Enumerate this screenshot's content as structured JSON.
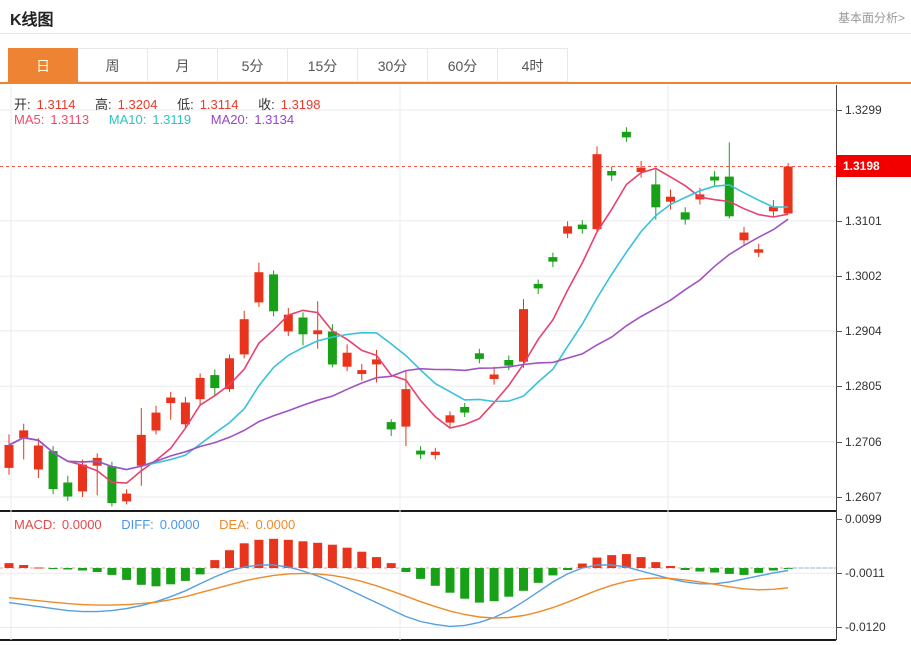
{
  "header": {
    "title": "K线图",
    "fundamental_link": "基本面分析>"
  },
  "tabs": {
    "items": [
      "日",
      "周",
      "月",
      "5分",
      "15分",
      "30分",
      "60分",
      "4时"
    ],
    "active_index": 0
  },
  "ohlc_legend": {
    "open_label": "开:",
    "open": "1.3114",
    "high_label": "高:",
    "high": "1.3204",
    "low_label": "低:",
    "low": "1.3114",
    "close_label": "收:",
    "close": "1.3198"
  },
  "ma_legend": {
    "ma5_label": "MA5:",
    "ma5": "1.3113",
    "ma10_label": "MA10:",
    "ma10": "1.3119",
    "ma20_label": "MA20:",
    "ma20": "1.3134"
  },
  "macd_legend": {
    "macd_label": "MACD:",
    "macd": "0.0000",
    "diff_label": "DIFF:",
    "diff": "0.0000",
    "dea_label": "DEA:",
    "dea": "0.0000"
  },
  "colors": {
    "up": "#e8341c",
    "down": "#18a018",
    "ma5": "#e8416e",
    "ma10": "#38c2da",
    "ma20": "#a052c4",
    "diff_line": "#54a0e0",
    "dea_line": "#ef8a2a",
    "value_red": "#e83a2a",
    "label_dark": "#333333",
    "ma5_text": "#ef4a6e",
    "ma10_text": "#2fc3c3",
    "ma20_text": "#9b45c8",
    "macd_text": "#e34a4a",
    "diff_text": "#4a96e8",
    "dea_text": "#ef8a2a",
    "tab_active_bg": "#ee8433",
    "badge_bg": "#f20000",
    "grid": "#e9ebee",
    "current_line": "#f55a4e"
  },
  "chart_data": {
    "type": "candlestick_with_macd",
    "title": "K线图 (daily K-line with MA5/MA10/MA20 and MACD)",
    "price_axis": {
      "ticks": [
        1.3299,
        1.3101,
        1.3002,
        1.2904,
        1.2805,
        1.2706,
        1.2607
      ],
      "range": [
        1.258,
        1.332
      ],
      "current_price": 1.3198,
      "current_price_label": "1.3198"
    },
    "macd_axis": {
      "ticks": [
        0.0099,
        -0.0011,
        -0.012
      ],
      "zero": 0
    },
    "ma_periods": [
      5,
      10,
      20
    ],
    "candles": {
      "columns": [
        "open",
        "high",
        "low",
        "close"
      ],
      "rows": [
        [
          1.2659,
          1.2719,
          1.2647,
          1.27
        ],
        [
          1.2712,
          1.2738,
          1.2674,
          1.2726
        ],
        [
          1.2656,
          1.2712,
          1.2641,
          1.2699
        ],
        [
          1.2689,
          1.2698,
          1.2612,
          1.2621
        ],
        [
          1.2633,
          1.2645,
          1.26,
          1.2608
        ],
        [
          1.2617,
          1.2674,
          1.2607,
          1.2665
        ],
        [
          1.2663,
          1.2685,
          1.261,
          1.2677
        ],
        [
          1.2662,
          1.267,
          1.259,
          1.2596
        ],
        [
          1.2599,
          1.2621,
          1.2594,
          1.2613
        ],
        [
          1.2663,
          1.2766,
          1.2627,
          1.2718
        ],
        [
          1.2726,
          1.277,
          1.2719,
          1.2758
        ],
        [
          1.2775,
          1.2795,
          1.2745,
          1.2785
        ],
        [
          1.2737,
          1.2786,
          1.273,
          1.2776
        ],
        [
          1.2782,
          1.2828,
          1.277,
          1.282
        ],
        [
          1.2825,
          1.2835,
          1.279,
          1.2802
        ],
        [
          1.28,
          1.2862,
          1.2795,
          1.2855
        ],
        [
          1.2862,
          1.294,
          1.2855,
          1.2925
        ],
        [
          1.2955,
          1.3026,
          1.2947,
          1.3009
        ],
        [
          1.3005,
          1.3012,
          1.293,
          1.2939
        ],
        [
          1.2903,
          1.2945,
          1.2895,
          1.2933
        ],
        [
          1.2928,
          1.2937,
          1.2878,
          1.2898
        ],
        [
          1.2898,
          1.2957,
          1.2872,
          1.2905
        ],
        [
          1.2903,
          1.2916,
          1.2839,
          1.2844
        ],
        [
          1.284,
          1.288,
          1.2832,
          1.2865
        ],
        [
          1.2827,
          1.2845,
          1.2815,
          1.2834
        ],
        [
          1.2844,
          1.287,
          1.2812,
          1.2853
        ],
        [
          1.2741,
          1.2746,
          1.2716,
          1.2728
        ],
        [
          1.2733,
          1.2832,
          1.2698,
          1.28
        ],
        [
          1.269,
          1.2698,
          1.2675,
          1.2683
        ],
        [
          1.2682,
          1.2695,
          1.2674,
          1.2688
        ],
        [
          1.274,
          1.276,
          1.273,
          1.2753
        ],
        [
          1.2768,
          1.2775,
          1.275,
          1.2758
        ],
        [
          1.2864,
          1.2872,
          1.2846,
          1.2854
        ],
        [
          1.2818,
          1.284,
          1.2808,
          1.2826
        ],
        [
          1.2852,
          1.286,
          1.2834,
          1.2842
        ],
        [
          1.2849,
          1.2961,
          1.2838,
          1.2943
        ],
        [
          1.2988,
          1.2996,
          1.297,
          1.298
        ],
        [
          1.3036,
          1.3044,
          1.3018,
          1.3028
        ],
        [
          1.3078,
          1.31,
          1.307,
          1.3091
        ],
        [
          1.3094,
          1.3102,
          1.3078,
          1.3086
        ],
        [
          1.3086,
          1.3234,
          1.308,
          1.322
        ],
        [
          1.319,
          1.3198,
          1.3172,
          1.3182
        ],
        [
          1.326,
          1.3268,
          1.3242,
          1.325
        ],
        [
          1.3188,
          1.3208,
          1.3178,
          1.3196
        ],
        [
          1.3166,
          1.3193,
          1.3103,
          1.3125
        ],
        [
          1.3135,
          1.3157,
          1.3121,
          1.3144
        ],
        [
          1.3116,
          1.3125,
          1.3094,
          1.3103
        ],
        [
          1.3139,
          1.316,
          1.313,
          1.3148
        ],
        [
          1.318,
          1.319,
          1.3162,
          1.3173
        ],
        [
          1.318,
          1.3241,
          1.3105,
          1.3109
        ],
        [
          1.3066,
          1.309,
          1.3058,
          1.308
        ],
        [
          1.3044,
          1.306,
          1.3036,
          1.305
        ],
        [
          1.3118,
          1.3138,
          1.3108,
          1.3126
        ],
        [
          1.3114,
          1.3204,
          1.3114,
          1.3198
        ]
      ]
    },
    "macd": {
      "histogram": [
        0.001,
        0.0006,
        0.0001,
        -0.0001,
        -0.0003,
        -0.0005,
        -0.0008,
        -0.0014,
        -0.0024,
        -0.0034,
        -0.0037,
        -0.0033,
        -0.0026,
        -0.0013,
        0.0016,
        0.0036,
        0.005,
        0.0057,
        0.0059,
        0.0057,
        0.0054,
        0.0051,
        0.0047,
        0.0041,
        0.0033,
        0.0022,
        0.001,
        -0.0008,
        -0.0022,
        -0.0036,
        -0.005,
        -0.0062,
        -0.007,
        -0.0067,
        -0.0058,
        -0.0046,
        -0.003,
        -0.0015,
        -0.0004,
        0.0009,
        0.0021,
        0.0026,
        0.0028,
        0.0022,
        0.0012,
        0.0004,
        -0.0004,
        -0.0007,
        -0.0009,
        -0.0012,
        -0.0014,
        -0.001,
        -0.0005,
        -0.0002
      ],
      "diff": [
        -0.007,
        -0.0074,
        -0.0078,
        -0.0082,
        -0.0086,
        -0.0088,
        -0.0088,
        -0.0086,
        -0.0082,
        -0.0076,
        -0.0068,
        -0.0058,
        -0.0046,
        -0.0032,
        -0.0018,
        -0.0006,
        0.0002,
        0.0006,
        0.0006,
        0.0002,
        -0.0006,
        -0.0016,
        -0.0028,
        -0.0042,
        -0.0056,
        -0.007,
        -0.0084,
        -0.0098,
        -0.0108,
        -0.0114,
        -0.0118,
        -0.0116,
        -0.011,
        -0.01,
        -0.0086,
        -0.0068,
        -0.0048,
        -0.0028,
        -0.0012,
        0.0,
        0.0006,
        0.0006,
        0.0002,
        -0.0006,
        -0.0014,
        -0.0022,
        -0.0028,
        -0.0032,
        -0.0032,
        -0.0028,
        -0.0022,
        -0.0016,
        -0.001,
        -0.0005
      ],
      "dea": [
        -0.006,
        -0.0063,
        -0.0066,
        -0.0069,
        -0.0072,
        -0.0074,
        -0.0075,
        -0.0075,
        -0.0074,
        -0.0072,
        -0.0069,
        -0.0064,
        -0.0058,
        -0.005,
        -0.0042,
        -0.0034,
        -0.0026,
        -0.002,
        -0.0015,
        -0.0012,
        -0.0011,
        -0.0012,
        -0.0015,
        -0.002,
        -0.0027,
        -0.0036,
        -0.0046,
        -0.0057,
        -0.0068,
        -0.0078,
        -0.0087,
        -0.0094,
        -0.0099,
        -0.0101,
        -0.01,
        -0.0096,
        -0.0089,
        -0.008,
        -0.0069,
        -0.0057,
        -0.0045,
        -0.0035,
        -0.0027,
        -0.0022,
        -0.002,
        -0.0021,
        -0.0024,
        -0.0028,
        -0.0033,
        -0.0038,
        -0.0042,
        -0.0044,
        -0.0043,
        -0.004
      ]
    }
  }
}
